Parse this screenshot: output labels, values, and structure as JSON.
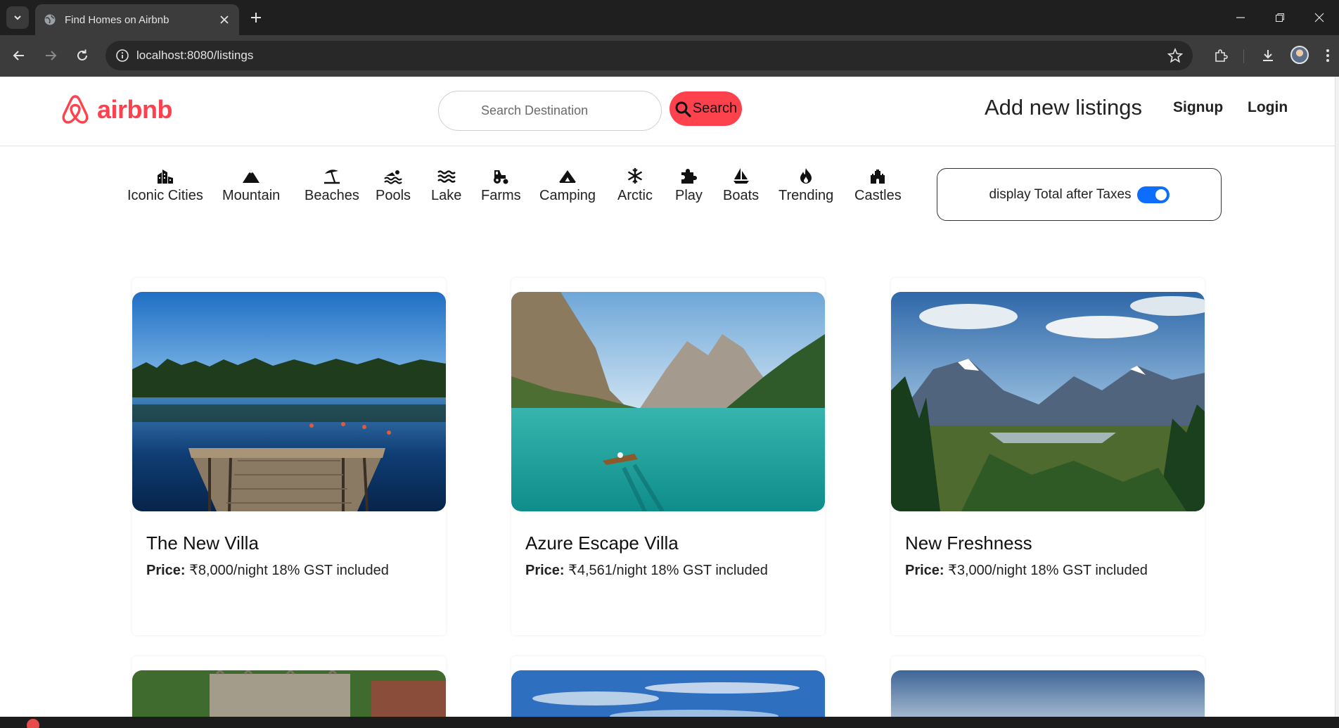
{
  "browser": {
    "tab_title": "Find Homes on Airbnb",
    "url": "localhost:8080/listings"
  },
  "navbar": {
    "brand": "airbnb",
    "search_placeholder": "Search Destination",
    "search_button": "Search",
    "add_listing": "Add new listings",
    "signup": "Signup",
    "login": "Login"
  },
  "filters": [
    {
      "label": "Iconic Cities",
      "icon": "city-icon"
    },
    {
      "label": "Mountain",
      "icon": "mountain-icon"
    },
    {
      "label": "Beaches",
      "icon": "umbrella-beach-icon"
    },
    {
      "label": "Pools",
      "icon": "swimmer-icon"
    },
    {
      "label": "Lake",
      "icon": "water-icon"
    },
    {
      "label": "Farms",
      "icon": "tractor-icon"
    },
    {
      "label": "Camping",
      "icon": "campground-icon"
    },
    {
      "label": "Arctic",
      "icon": "snowflake-icon"
    },
    {
      "label": "Play",
      "icon": "puzzle-icon"
    },
    {
      "label": "Boats",
      "icon": "sailboat-icon"
    },
    {
      "label": "Trending",
      "icon": "fire-icon"
    },
    {
      "label": "Castles",
      "icon": "castle-icon"
    }
  ],
  "tax_toggle": {
    "label": "display Total after Taxes",
    "enabled": true
  },
  "listings": [
    {
      "title": "The New Villa",
      "price_label": "Price:",
      "price": "₹8,000/night",
      "tax_note": "18% GST included"
    },
    {
      "title": "Azure Escape Villa",
      "price_label": "Price:",
      "price": "₹4,561/night",
      "tax_note": "18% GST included"
    },
    {
      "title": "New Freshness",
      "price_label": "Price:",
      "price": "₹3,000/night",
      "tax_note": "18% GST included"
    }
  ],
  "colors": {
    "brand": "#fe424d",
    "toggle_on": "#0d6efd"
  }
}
